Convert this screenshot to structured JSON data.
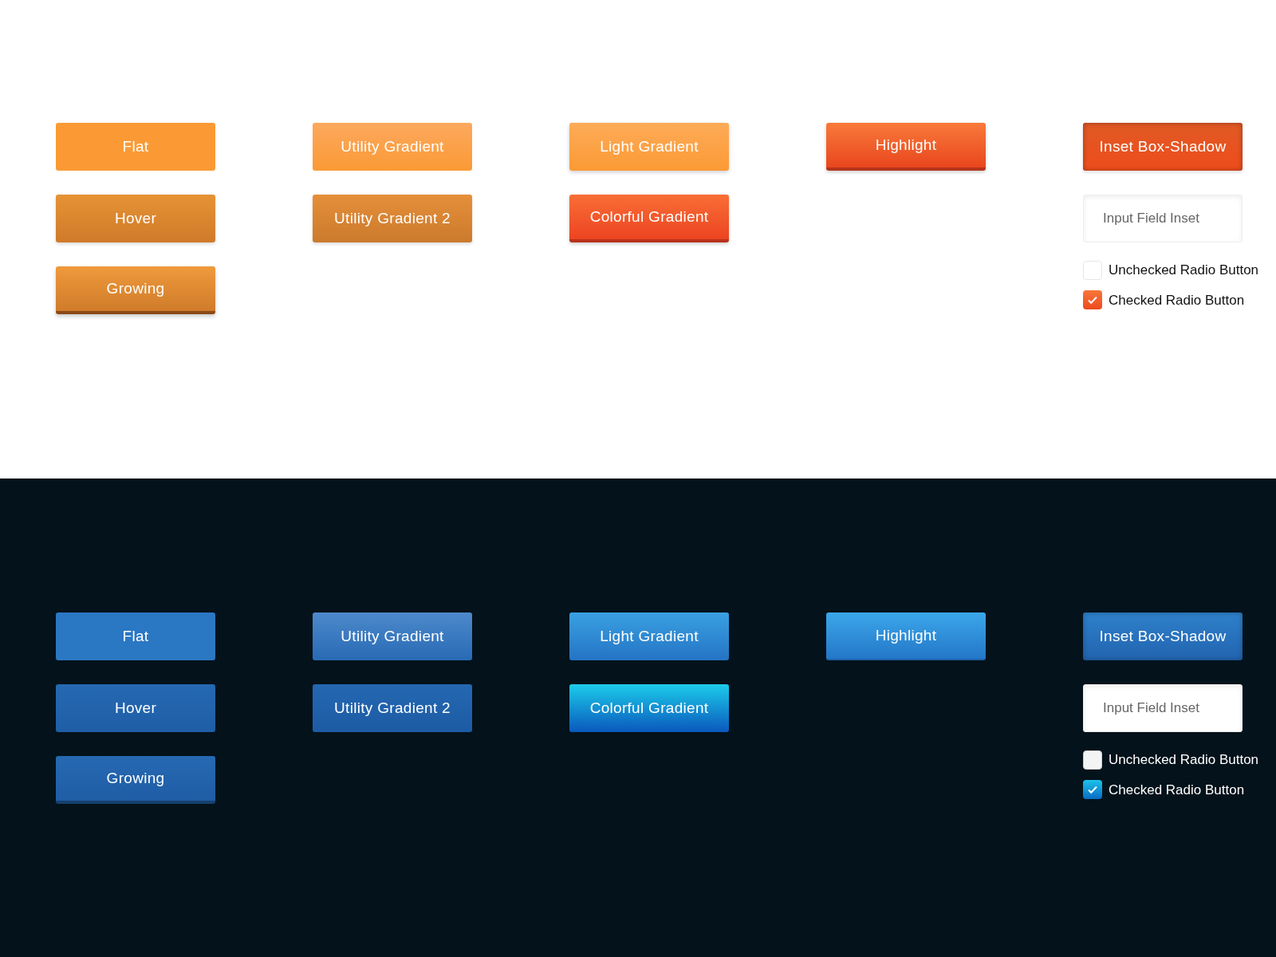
{
  "sections": [
    {
      "dark": false,
      "columns": [
        [
          {
            "kind": "flat",
            "label": "Flat"
          },
          {
            "kind": "hover",
            "label": "Hover"
          },
          {
            "kind": "growing",
            "label": "Growing"
          }
        ],
        [
          {
            "kind": "utility",
            "label": "Utility Gradient"
          },
          {
            "kind": "utility2",
            "label": "Utility Gradient 2"
          }
        ],
        [
          {
            "kind": "light",
            "label": "Light Gradient"
          },
          {
            "kind": "colorful",
            "label": "Colorful Gradient"
          }
        ],
        [
          {
            "kind": "highlight",
            "label": "Highlight"
          }
        ],
        [
          {
            "kind": "inset",
            "label": "Inset Box-Shadow"
          },
          {
            "kind": "input",
            "placeholder": "Input Field Inset"
          },
          {
            "kind": "option",
            "label": "Unchecked Radio Button",
            "checked": false
          },
          {
            "kind": "option",
            "label": "Checked Radio Button",
            "checked": true
          }
        ]
      ]
    },
    {
      "dark": true,
      "columns": [
        [
          {
            "kind": "flat",
            "label": "Flat"
          },
          {
            "kind": "hover",
            "label": "Hover"
          },
          {
            "kind": "growing",
            "label": "Growing"
          }
        ],
        [
          {
            "kind": "utility",
            "label": "Utility Gradient"
          },
          {
            "kind": "utility2",
            "label": "Utility Gradient 2"
          }
        ],
        [
          {
            "kind": "light",
            "label": "Light Gradient"
          },
          {
            "kind": "colorful",
            "label": "Colorful Gradient"
          }
        ],
        [
          {
            "kind": "highlight",
            "label": "Highlight"
          }
        ],
        [
          {
            "kind": "inset",
            "label": "Inset Box-Shadow"
          },
          {
            "kind": "input",
            "placeholder": "Input Field Inset"
          },
          {
            "kind": "option",
            "label": "Unchecked Radio Button",
            "checked": false
          },
          {
            "kind": "option",
            "label": "Checked Radio Button",
            "checked": true
          }
        ]
      ]
    }
  ]
}
